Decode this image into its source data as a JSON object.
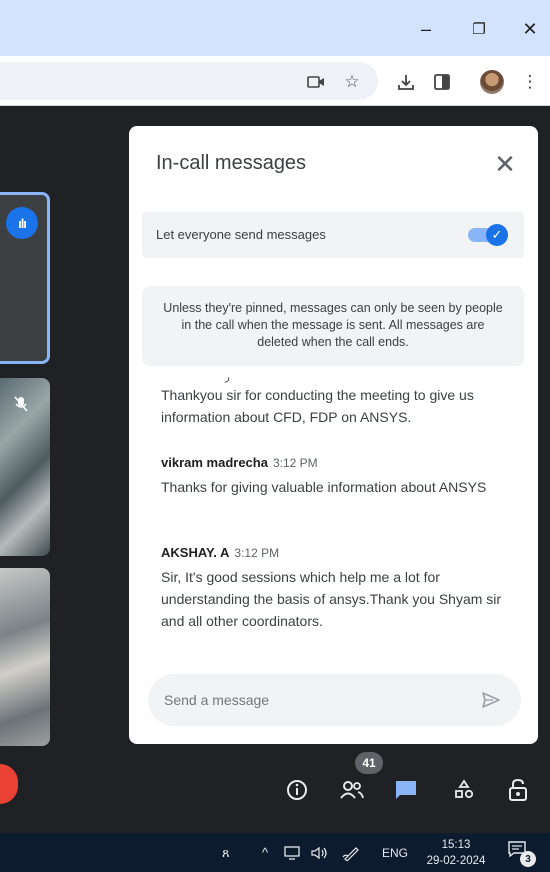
{
  "window_controls": {
    "minimize": "–",
    "restore": "❐",
    "close": "✕"
  },
  "toolbar_icons": [
    "camera-icon",
    "bookmark-star-icon",
    "download-icon",
    "side-panel-icon",
    "profile-avatar",
    "more-menu-icon"
  ],
  "panel": {
    "title": "In-call messages",
    "close_label": "✕",
    "toggle_label": "Let everyone send messages",
    "toggle_on": true,
    "notice": "Unless they're pinned, messages can only be seen by people in the call when the message is sent. All messages are deleted when the call ends.",
    "fragment": "ر"
  },
  "messages": [
    {
      "sender": "",
      "time": "",
      "text": "Thankyou sir for conducting the meeting to give us information about CFD, FDP on ANSYS."
    },
    {
      "sender": "vikram madrecha",
      "time": "3:12 PM",
      "text": "Thanks for giving valuable information about ANSYS"
    },
    {
      "sender": "AKSHAY. A",
      "time": "3:12 PM",
      "text": "Sir, It's  good sessions which help me a lot for understanding the basis of ansys.Thank you Shyam sir and all other coordinators."
    }
  ],
  "composer": {
    "placeholder": "Send a message"
  },
  "bottom_bar": {
    "participant_count": "41"
  },
  "taskbar": {
    "language": "ENG",
    "time": "15:13",
    "date": "29-02-2024",
    "notification_count": "3"
  },
  "colors": {
    "accent": "#1a73e8",
    "titlebar": "#d3e3fd",
    "meet_bg": "#202124",
    "end_call": "#ea4335"
  }
}
